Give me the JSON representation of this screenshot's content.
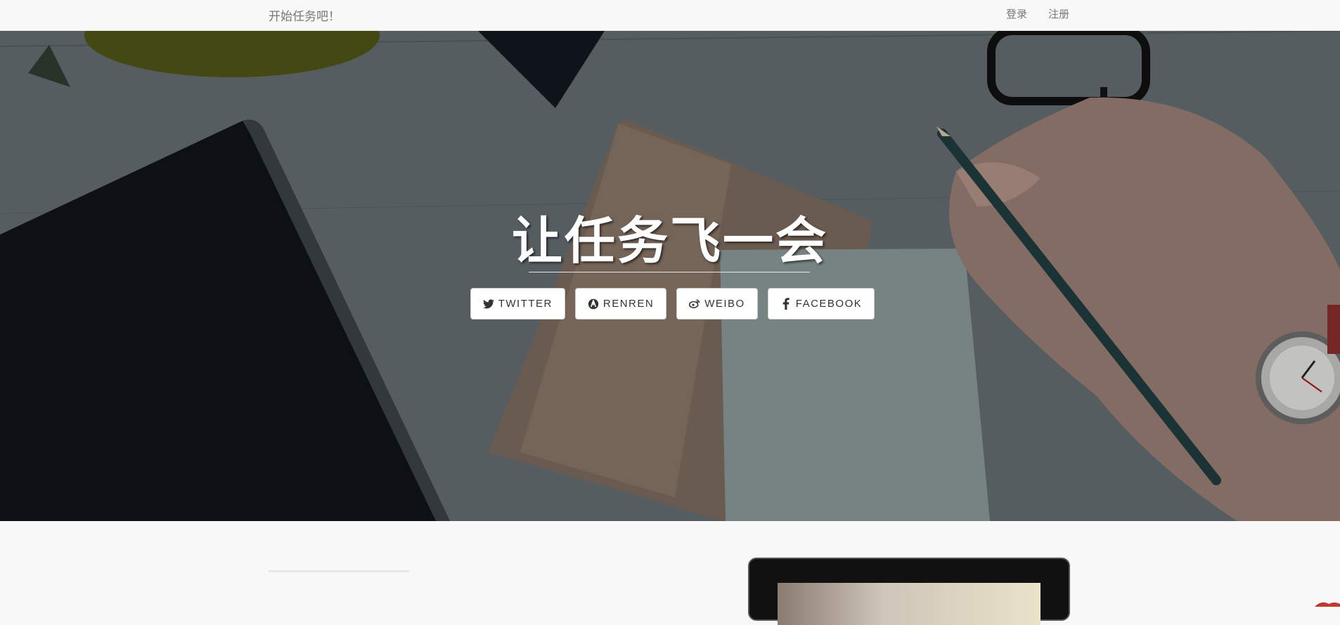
{
  "navbar": {
    "brand": "开始任务吧！",
    "links": [
      "登录",
      "注册"
    ]
  },
  "hero": {
    "title": "让任务飞一会",
    "social_buttons": [
      {
        "label": "TWITTER",
        "icon": "twitter-icon"
      },
      {
        "label": "RENREN",
        "icon": "renren-icon"
      },
      {
        "label": "WEIBO",
        "icon": "weibo-icon"
      },
      {
        "label": "FACEBOOK",
        "icon": "facebook-icon"
      }
    ]
  },
  "colors": {
    "navbar_bg": "#f8f8f8",
    "nav_text": "#777777",
    "button_bg": "#ffffff",
    "hero_text": "#ffffff"
  }
}
